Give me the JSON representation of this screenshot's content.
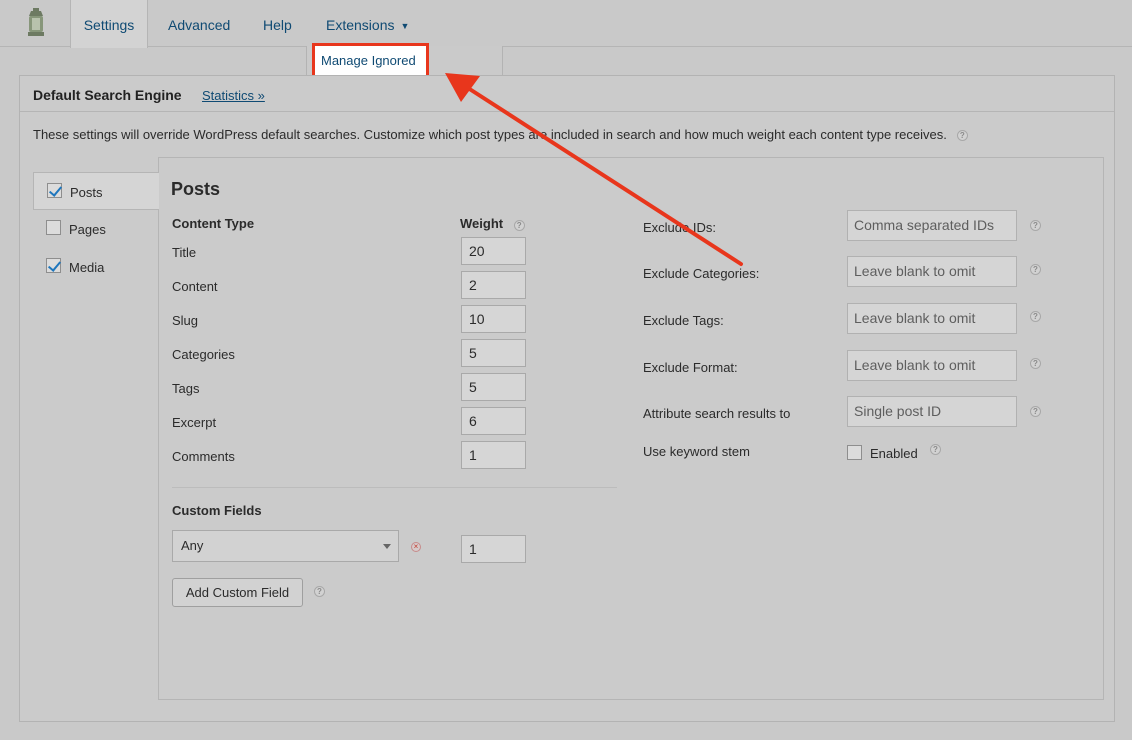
{
  "nav": {
    "tabs": [
      {
        "label": "Settings"
      },
      {
        "label": "Advanced"
      },
      {
        "label": "Help"
      },
      {
        "label": "Extensions"
      }
    ],
    "active_tab": "Settings",
    "extensions_caret": "▼",
    "dropdown": {
      "items": [
        {
          "label": "Manage Ignored"
        }
      ]
    }
  },
  "panel": {
    "title": "Default Search Engine",
    "stats_link": "Statistics »",
    "intro": "These settings will override WordPress default searches. Customize which post types are included in search and how much weight each content type receives.",
    "help_glyph": "?"
  },
  "post_types": [
    {
      "label": "Posts",
      "checked": true,
      "active": true
    },
    {
      "label": "Pages",
      "checked": false,
      "active": false
    },
    {
      "label": "Media",
      "checked": true,
      "active": false
    }
  ],
  "section": {
    "title": "Posts",
    "content_type_header": "Content Type",
    "weight_header": "Weight",
    "rows": [
      {
        "label": "Title",
        "weight": "20"
      },
      {
        "label": "Content",
        "weight": "2"
      },
      {
        "label": "Slug",
        "weight": "10"
      },
      {
        "label": "Categories",
        "weight": "5"
      },
      {
        "label": "Tags",
        "weight": "5"
      },
      {
        "label": "Excerpt",
        "weight": "6"
      },
      {
        "label": "Comments",
        "weight": "1"
      }
    ],
    "custom_fields": {
      "header": "Custom Fields",
      "select_value": "Any",
      "remove_glyph": "×",
      "weight": "1",
      "add_button": "Add Custom Field"
    },
    "options": [
      {
        "label": "Exclude IDs:",
        "placeholder": "Comma separated IDs"
      },
      {
        "label": "Exclude Categories:",
        "placeholder": "Leave blank to omit"
      },
      {
        "label": "Exclude Tags:",
        "placeholder": "Leave blank to omit"
      },
      {
        "label": "Exclude Format:",
        "placeholder": "Leave blank to omit"
      },
      {
        "label": "Attribute search results to",
        "placeholder": "Single post ID"
      }
    ],
    "keyword_stem": {
      "label": "Use keyword stem",
      "checkbox_label": "Enabled",
      "checked": false
    }
  },
  "colors": {
    "annotation": "#e8361c",
    "link": "#0f4a73",
    "checkbox_check": "#1e76bd"
  }
}
